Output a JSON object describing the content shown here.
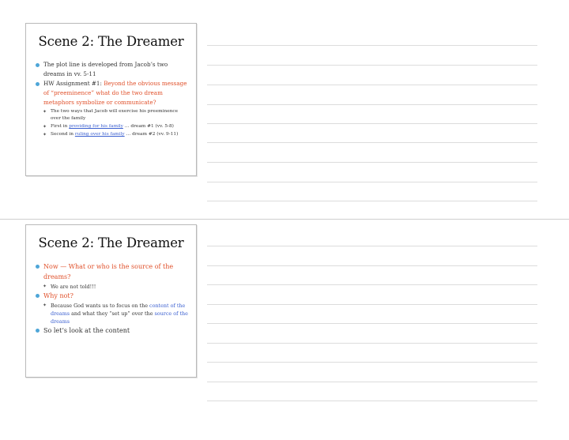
{
  "slides": [
    {
      "title": "Scene 2: The Dreamer",
      "b1": "The plot line is developed from Jacob’s two dreams in vv. 5-11",
      "b2_pre": "HW Assignment #1: ",
      "b2_red": "Beyond the obvious message of “preeminence” what do the two dream metaphors symbolize or communicate?",
      "sub1": "The two ways that Jacob will exercise his preeminence over the family",
      "sub2_pre": "First in ",
      "sub2_link": "providing for his family",
      "sub2_post": " … dream #1 (vv. 5-8)",
      "sub3_pre": "Second in ",
      "sub3_link": "ruling over his family",
      "sub3_post": " … dream #2 (vv. 9-11)"
    },
    {
      "title": "Scene 2: The Dreamer",
      "b1": "Now — What or who is the source of the dreams?",
      "sub1": "We are not told!!!",
      "b2": "Why not?",
      "sub2_a": "Because God wants us to focus on the ",
      "sub2_b": "content of the dreams",
      "sub2_c": " and what they “set up” over the ",
      "sub2_d": "source of the dreams",
      "b3": "So let’s look at the content"
    }
  ],
  "colors": {
    "bullet": "#4ea6d8",
    "red": "#e0502a",
    "blue": "#3a5fd0"
  }
}
